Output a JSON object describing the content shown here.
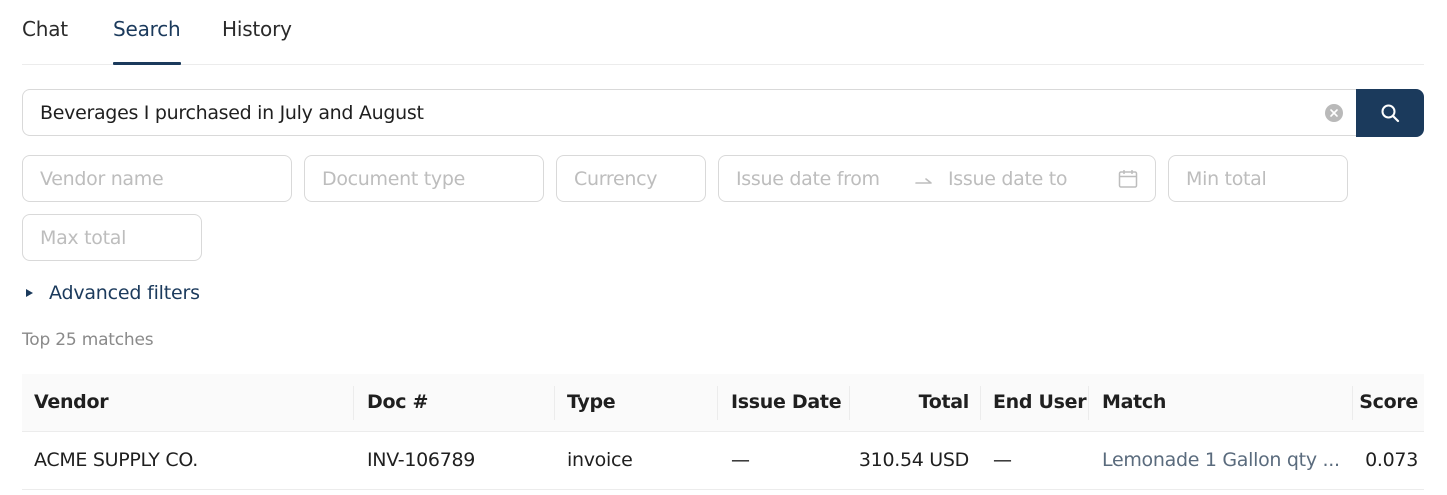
{
  "tabs": [
    {
      "label": "Chat",
      "active": false
    },
    {
      "label": "Search",
      "active": true
    },
    {
      "label": "History",
      "active": false
    }
  ],
  "search": {
    "query": "Beverages I purchased in July and August",
    "clear_icon": "clear-circle-icon",
    "button_icon": "search-icon"
  },
  "filters": {
    "vendor_placeholder": "Vendor name",
    "doc_type_placeholder": "Document type",
    "currency_placeholder": "Currency",
    "issue_date_from_placeholder": "Issue date from",
    "issue_date_to_placeholder": "Issue date to",
    "min_total_placeholder": "Min total",
    "max_total_placeholder": "Max total",
    "advanced_label": "Advanced filters"
  },
  "results": {
    "summary": "Top 25 matches",
    "columns": [
      "Vendor",
      "Doc #",
      "Type",
      "Issue Date",
      "Total",
      "End User",
      "Match",
      "Score"
    ],
    "rows": [
      {
        "vendor": "ACME SUPPLY CO.",
        "doc": "INV-106789",
        "type": "invoice",
        "issue_date": "—",
        "total": "310.54 USD",
        "end_user": "—",
        "match": "Lemonade 1 Gallon qty ...",
        "score": "0.073"
      }
    ]
  },
  "colors": {
    "accent": "#1b3a5c",
    "border": "#d9d9d9",
    "placeholder": "#bdbdbd",
    "header_bg": "#fafafa"
  }
}
